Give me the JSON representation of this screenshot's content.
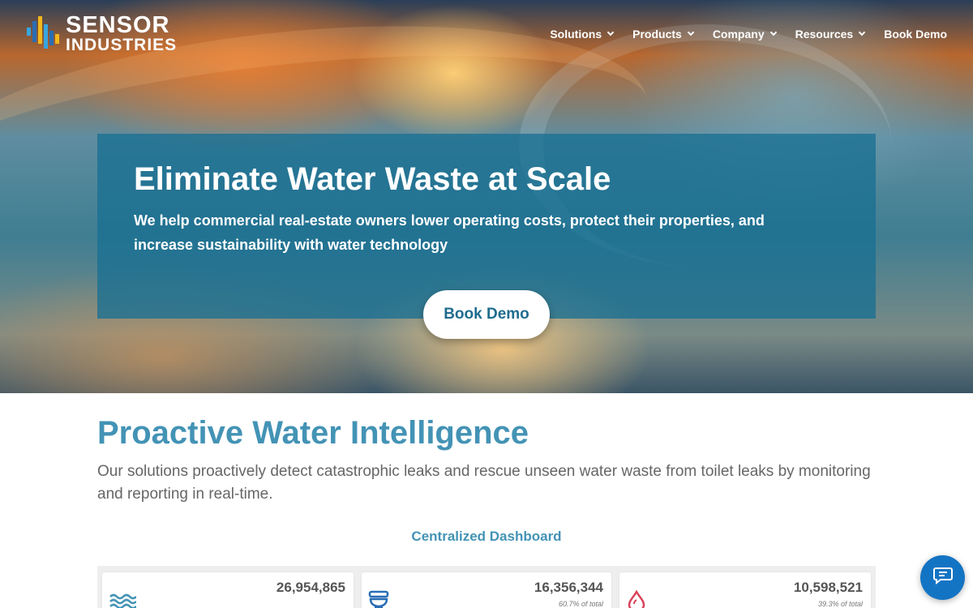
{
  "brand": {
    "name_line1": "SENSOR",
    "name_line2": "INDUSTRIES",
    "logo_icon": "sensor-bars-logo",
    "accent": "#4393b5"
  },
  "nav": {
    "items": [
      {
        "label": "Solutions",
        "has_dropdown": true
      },
      {
        "label": "Products",
        "has_dropdown": true
      },
      {
        "label": "Company",
        "has_dropdown": true
      },
      {
        "label": "Resources",
        "has_dropdown": true
      },
      {
        "label": "Book Demo",
        "has_dropdown": false
      }
    ]
  },
  "hero": {
    "title": "Eliminate Water Waste at Scale",
    "subtitle": "We help commercial real-estate owners lower operating costs, protect their properties, and increase sustainability with water technology",
    "cta_label": "Book Demo",
    "panel_color": "#1a7092"
  },
  "section": {
    "title": "Proactive Water Intelligence",
    "description": "Our solutions proactively detect catastrophic leaks and rescue unseen water waste from toilet leaks by monitoring and reporting in real-time.",
    "dashboard_label": "Centralized Dashboard"
  },
  "dashboard_cards": [
    {
      "value": "26,954,865",
      "pct": "",
      "icon": "water-waves-icon",
      "icon_color": "#4393b5"
    },
    {
      "value": "16,356,344",
      "pct": "60.7% of total",
      "icon": "toilet-icon",
      "icon_color": "#2a6db5"
    },
    {
      "value": "10,598,521",
      "pct": "39.3% of total",
      "icon": "water-drop-icon",
      "icon_color": "#d9435a"
    }
  ],
  "chat": {
    "icon": "chat-icon",
    "color": "#1474c4"
  }
}
